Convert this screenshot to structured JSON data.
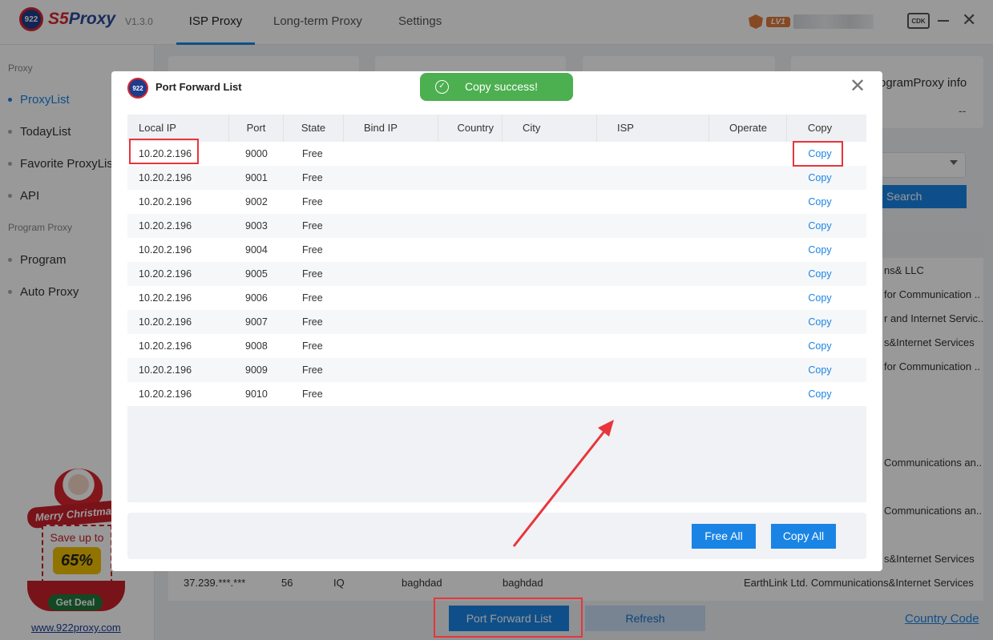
{
  "app": {
    "logo_badge": "922",
    "logo_name_prefix": "S5",
    "logo_name_suffix": "Proxy",
    "version": "V1.3.0",
    "vip_level": "LV1",
    "cdk_label": "CDK"
  },
  "nav": {
    "tabs": [
      {
        "label": "ISP Proxy",
        "active": true
      },
      {
        "label": "Long-term Proxy",
        "active": false
      },
      {
        "label": "Settings",
        "active": false
      }
    ]
  },
  "sidebar": {
    "group_proxy": "Proxy",
    "items_proxy": [
      {
        "label": "ProxyList",
        "active": true
      },
      {
        "label": "TodayList",
        "active": false
      },
      {
        "label": "Favorite ProxyList",
        "active": false
      },
      {
        "label": "API",
        "active": false
      }
    ],
    "group_program": "Program Proxy",
    "items_program": [
      {
        "label": "Program",
        "active": false
      },
      {
        "label": "Auto Proxy",
        "active": false
      }
    ]
  },
  "promo": {
    "banner": "Merry Christmas",
    "save_text": "Save up to",
    "percent": "65%",
    "cta": "Get Deal",
    "link": "www.922proxy.com"
  },
  "background": {
    "card_title": "ogramProxy info",
    "card_value": "--",
    "search_button": "Search",
    "isp_fragments": [
      "ns& LLC",
      "for Communication ..",
      "r and Internet Servic..",
      "s&Internet Services",
      "for Communication ..",
      "Communications an..",
      "Communications an..",
      "s&Internet Services"
    ],
    "visible_row": {
      "ip": "37.239.***.***",
      "port": "56",
      "country": "IQ",
      "state": "baghdad",
      "city": "baghdad",
      "isp": "EarthLink Ltd. Communications&Internet Services"
    },
    "port_forward_button": "Port Forward List",
    "refresh_button": "Refresh",
    "country_code_link": "Country Code"
  },
  "toast": {
    "message": "Copy success!"
  },
  "modal": {
    "logo_badge": "922",
    "title": "Port Forward List",
    "columns": [
      "Local IP",
      "Port",
      "State",
      "Bind IP",
      "Country",
      "City",
      "ISP",
      "Operate",
      "Copy"
    ],
    "rows": [
      {
        "local_ip": "10.20.2.196",
        "port": "9000",
        "state": "Free",
        "copy": "Copy"
      },
      {
        "local_ip": "10.20.2.196",
        "port": "9001",
        "state": "Free",
        "copy": "Copy"
      },
      {
        "local_ip": "10.20.2.196",
        "port": "9002",
        "state": "Free",
        "copy": "Copy"
      },
      {
        "local_ip": "10.20.2.196",
        "port": "9003",
        "state": "Free",
        "copy": "Copy"
      },
      {
        "local_ip": "10.20.2.196",
        "port": "9004",
        "state": "Free",
        "copy": "Copy"
      },
      {
        "local_ip": "10.20.2.196",
        "port": "9005",
        "state": "Free",
        "copy": "Copy"
      },
      {
        "local_ip": "10.20.2.196",
        "port": "9006",
        "state": "Free",
        "copy": "Copy"
      },
      {
        "local_ip": "10.20.2.196",
        "port": "9007",
        "state": "Free",
        "copy": "Copy"
      },
      {
        "local_ip": "10.20.2.196",
        "port": "9008",
        "state": "Free",
        "copy": "Copy"
      },
      {
        "local_ip": "10.20.2.196",
        "port": "9009",
        "state": "Free",
        "copy": "Copy"
      },
      {
        "local_ip": "10.20.2.196",
        "port": "9010",
        "state": "Free",
        "copy": "Copy"
      }
    ],
    "free_all_button": "Free All",
    "copy_all_button": "Copy All"
  },
  "colors": {
    "accent": "#1a84e5",
    "toast_green": "#4caf50",
    "annotation_red": "#e8353b"
  }
}
